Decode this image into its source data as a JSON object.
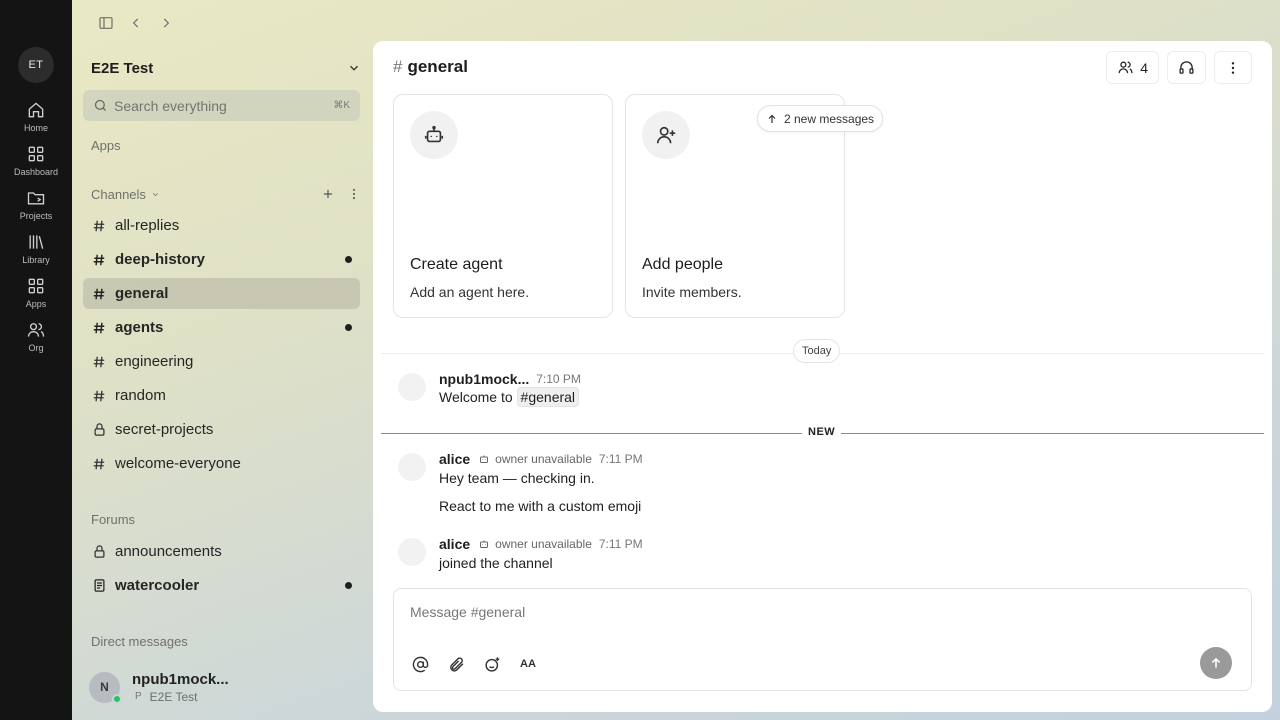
{
  "rail": {
    "workspace_badge": "ET",
    "items": [
      {
        "label": "Home",
        "icon": "home-icon"
      },
      {
        "label": "Dashboard",
        "icon": "dashboard-icon"
      },
      {
        "label": "Projects",
        "icon": "projects-icon"
      },
      {
        "label": "Library",
        "icon": "library-icon"
      },
      {
        "label": "Apps",
        "icon": "apps-icon"
      },
      {
        "label": "Org",
        "icon": "org-icon"
      }
    ]
  },
  "sidebar": {
    "workspace_name": "E2E Test",
    "search_placeholder": "Search everything",
    "search_shortcut": "⌘K",
    "apps_label": "Apps",
    "channels_label": "Channels",
    "channels": [
      {
        "name": "all-replies",
        "icon": "hash",
        "unread": false,
        "active": false
      },
      {
        "name": "deep-history",
        "icon": "hash",
        "unread": true,
        "active": false
      },
      {
        "name": "general",
        "icon": "hash",
        "unread": false,
        "active": true
      },
      {
        "name": "agents",
        "icon": "hash",
        "unread": true,
        "active": false
      },
      {
        "name": "engineering",
        "icon": "hash",
        "unread": false,
        "active": false
      },
      {
        "name": "random",
        "icon": "hash",
        "unread": false,
        "active": false
      },
      {
        "name": "secret-projects",
        "icon": "lock",
        "unread": false,
        "active": false
      },
      {
        "name": "welcome-everyone",
        "icon": "hash",
        "unread": false,
        "active": false
      }
    ],
    "forums_label": "Forums",
    "forums": [
      {
        "name": "announcements",
        "icon": "lock",
        "unread": false
      },
      {
        "name": "watercooler",
        "icon": "document",
        "unread": true
      }
    ],
    "dm_label": "Direct messages",
    "dm": {
      "initial": "N",
      "name": "npub1mock...",
      "sub_icon": "P",
      "sub": "E2E Test"
    }
  },
  "channel": {
    "hash": "#",
    "title": "general",
    "member_count": "4"
  },
  "cards": [
    {
      "title": "Create agent",
      "subtitle": "Add an agent here.",
      "icon": "robot-icon"
    },
    {
      "title": "Add people",
      "subtitle": "Invite members.",
      "icon": "add-user-icon"
    }
  ],
  "new_messages_pill": "2 new messages",
  "today_label": "Today",
  "new_label": "NEW",
  "messages": [
    {
      "author": "npub1mock...",
      "time": "7:10 PM",
      "text_prefix": "Welcome to ",
      "channel_mention": "#general"
    },
    {
      "author": "alice",
      "tag": "owner unavailable",
      "time": "7:11 PM",
      "lines": [
        "Hey team — checking in.",
        "React to me with a custom emoji"
      ]
    },
    {
      "author": "alice",
      "tag": "owner unavailable",
      "time": "7:11 PM",
      "lines": [
        "joined the channel"
      ]
    }
  ],
  "composer": {
    "placeholder": "Message #general",
    "format_label": "AA"
  }
}
